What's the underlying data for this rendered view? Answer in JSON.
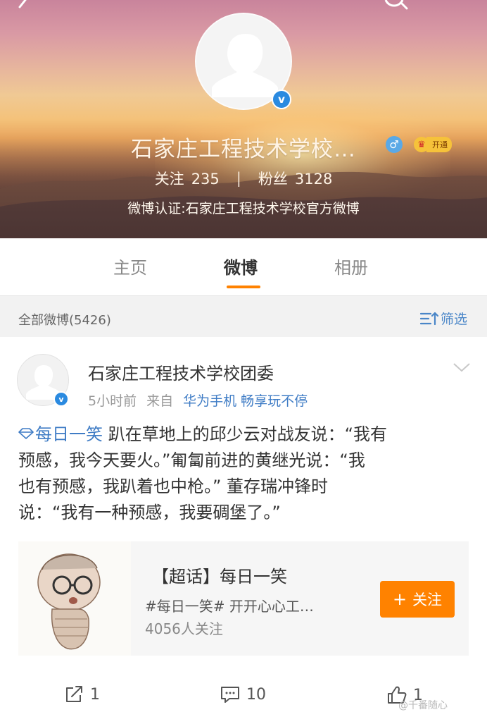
{
  "profile": {
    "name": "石家庄工程技术学校…",
    "following_label": "关注",
    "following_count": "235",
    "followers_label": "粉丝",
    "followers_count": "3128",
    "separator": "|",
    "verification": "微博认证:石家庄工程技术学校官方微博",
    "vip_label": "开通",
    "gender": "male"
  },
  "tabs": [
    {
      "label": "主页",
      "active": false
    },
    {
      "label": "微博",
      "active": true
    },
    {
      "label": "相册",
      "active": false
    }
  ],
  "filter_bar": {
    "all_label": "全部微博(5426)",
    "filter_label": "筛选"
  },
  "post": {
    "author": "石家庄工程技术学校团委",
    "time": "5小时前",
    "from_label": "来自",
    "source": "华为手机 畅享玩不停",
    "hashtag": "每日一笑",
    "line1_rest": " 趴在草地上的邱少云对战友说：“我有",
    "line2": "预感，我今天要火。”匍匐前进的黄继光说：“我",
    "line3": "也有预感，我趴着也中枪。” 董存瑞冲锋时",
    "line4": "说：“我有一种预感，我要碉堡了。”"
  },
  "topic_card": {
    "title": "【超话】每日一笑",
    "description": "#每日一笑# 开开心心工…",
    "followers": "4056人关注",
    "follow_button": "关注"
  },
  "actions": {
    "repost_count": "1",
    "comment_count": "10",
    "like_count": "1"
  },
  "watermark": "@千番随心",
  "colors": {
    "accent_orange": "#ff8200",
    "link_blue": "#3f7cc5",
    "verified_blue": "#2a8ae0"
  }
}
